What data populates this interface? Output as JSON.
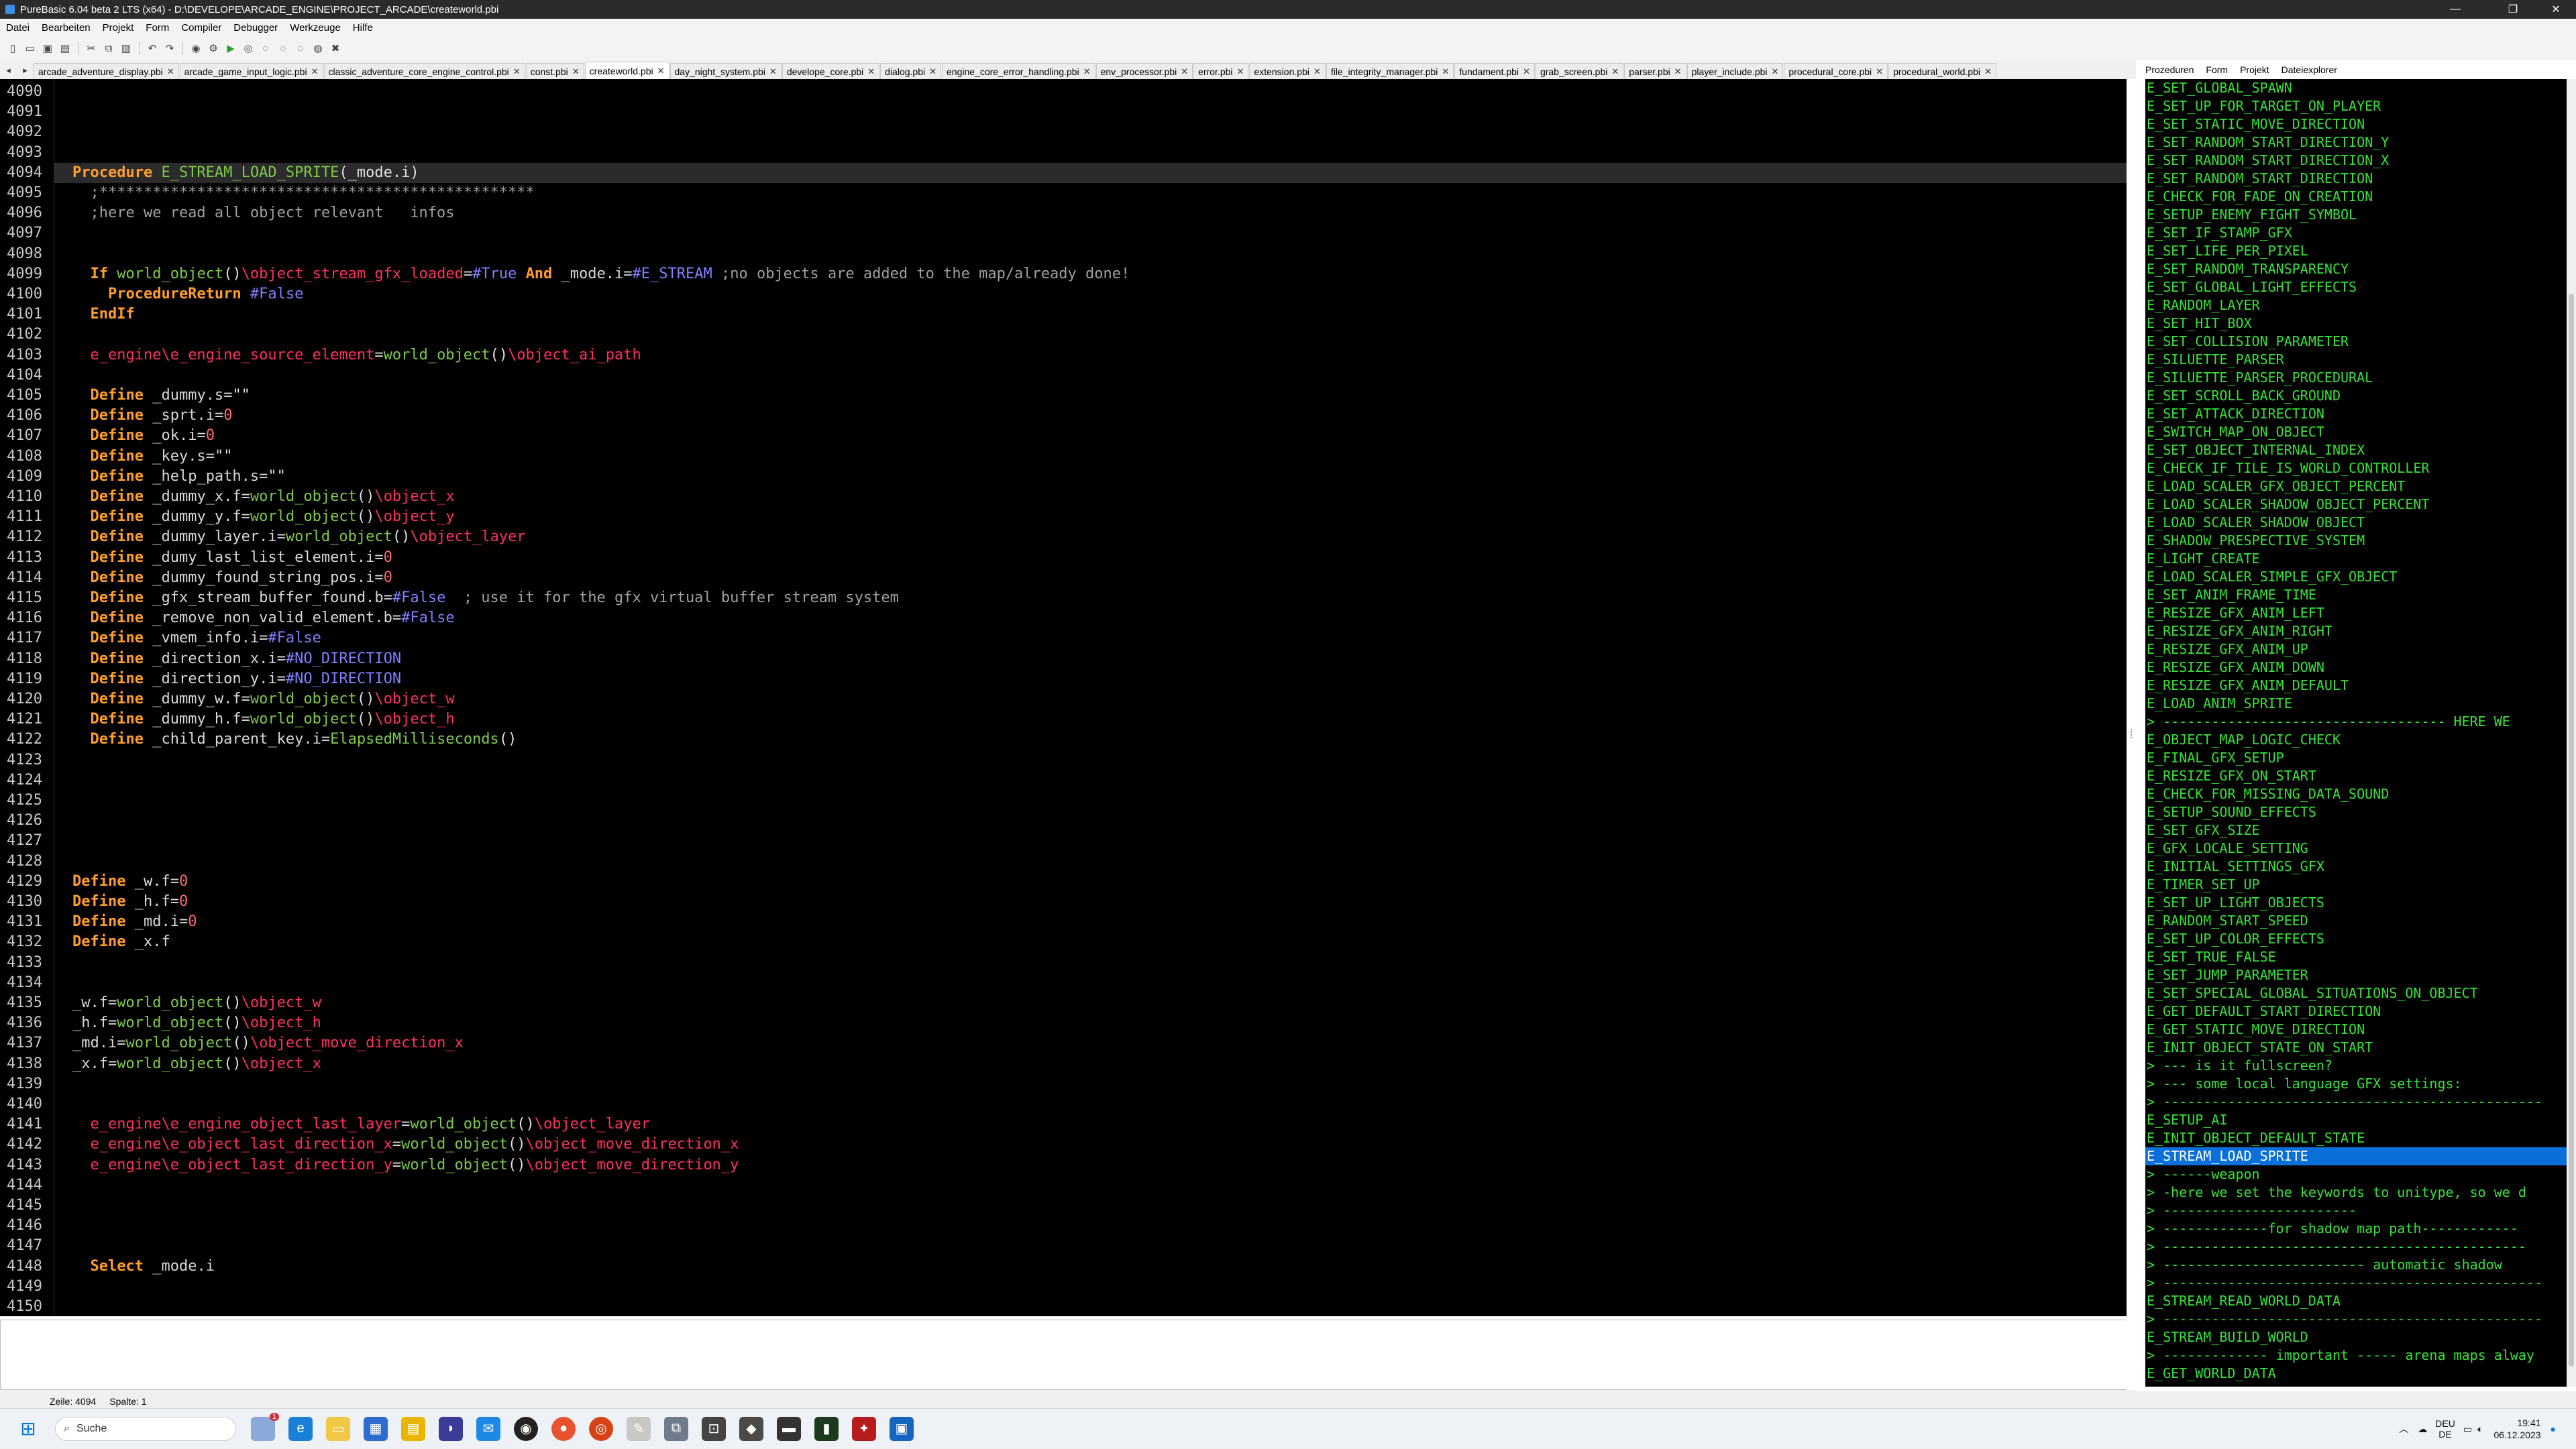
{
  "titlebar": {
    "title": "PureBasic 6.04 beta 2 LTS (x64) - D:\\DEVELOPE\\ARCADE_ENGINE\\PROJECT_ARCADE\\createworld.pbi",
    "minimize": "—",
    "maximize": "❐",
    "close": "✕"
  },
  "menu": [
    "Datei",
    "Bearbeiten",
    "Projekt",
    "Form",
    "Compiler",
    "Debugger",
    "Werkzeuge",
    "Hilfe"
  ],
  "tabs": [
    "arcade_adventure_display.pbi",
    "arcade_game_input_logic.pbi",
    "classic_adventure_core_engine_control.pbi",
    "const.pbi",
    "createworld.pbi",
    "day_night_system.pbi",
    "develope_core.pbi",
    "dialog.pbi",
    "engine_core_error_handling.pbi",
    "env_processor.pbi",
    "error.pbi",
    "extension.pbi",
    "file_integrity_manager.pbi",
    "fundament.pbi",
    "grab_screen.pbi",
    "parser.pbi",
    "player_include.pbi",
    "procedural_core.pbi",
    "procedural_world.pbi"
  ],
  "active_tab": "createworld.pbi",
  "editor": {
    "line_numbers": [
      "4090",
      "4091",
      "4092",
      "4093",
      "4094",
      "4095",
      "4096",
      "4097",
      "4098",
      "4099",
      "4100",
      "4101",
      "4102",
      "4103",
      "4104",
      "4105",
      "4106",
      "4107",
      "4108",
      "4109",
      "4110",
      "4111",
      "4112",
      "4113",
      "4114",
      "4115",
      "4116",
      "4117",
      "4118",
      "4119",
      "4120",
      "4121",
      "4122",
      "4123",
      "4124",
      "4125",
      "4126",
      "4127",
      "4128",
      "4129",
      "4130",
      "4131",
      "4132",
      "4133",
      "4134",
      "4135",
      "4136",
      "4137",
      "4138",
      "4139",
      "4140",
      "4141",
      "4142",
      "4143",
      "4144",
      "4145",
      "4146",
      "4147",
      "4148",
      "4149",
      "4150"
    ],
    "lines": [
      {
        "i": 4,
        "cur": true,
        "t": [
          [
            "kw",
            "Procedure "
          ],
          [
            "fn",
            "E_STREAM_LOAD_SPRITE"
          ],
          [
            "br",
            "(_mode.i)"
          ]
        ]
      },
      {
        "i": 5,
        "t": [
          [
            "cm",
            "  ;*************************************************"
          ]
        ]
      },
      {
        "i": 6,
        "t": [
          [
            "cm",
            "  ;here we read all object relevant   infos"
          ]
        ]
      },
      {
        "i": 9,
        "t": [
          [
            "kw",
            "  If "
          ],
          [
            "fn",
            "world_object"
          ],
          [
            "br",
            "()"
          ],
          [
            "rg",
            "\\object_stream_gfx_loaded"
          ],
          [
            "op",
            "="
          ],
          [
            "ct",
            "#True "
          ],
          [
            "kw",
            "And "
          ],
          [
            "vr",
            "_mode.i"
          ],
          [
            "op",
            "="
          ],
          [
            "ct",
            "#E_STREAM "
          ],
          [
            "cm",
            ";no objects are added to the map/already done!"
          ]
        ]
      },
      {
        "i": 10,
        "t": [
          [
            "kw",
            "    ProcedureReturn "
          ],
          [
            "ct",
            "#False"
          ]
        ]
      },
      {
        "i": 11,
        "t": [
          [
            "kw",
            "  EndIf"
          ]
        ]
      },
      {
        "i": 13,
        "t": [
          [
            "rg",
            "  e_engine\\e_engine_source_element"
          ],
          [
            "op",
            "="
          ],
          [
            "fn",
            "world_object"
          ],
          [
            "br",
            "()"
          ],
          [
            "rg",
            "\\object_ai_path"
          ]
        ]
      },
      {
        "i": 15,
        "t": [
          [
            "kw",
            "  Define "
          ],
          [
            "vr",
            "_dummy.s"
          ],
          [
            "op",
            "="
          ],
          [
            "st",
            "\"\""
          ]
        ]
      },
      {
        "i": 16,
        "t": [
          [
            "kw",
            "  Define "
          ],
          [
            "vr",
            "_sprt.i"
          ],
          [
            "op",
            "="
          ],
          [
            "nm",
            "0"
          ]
        ]
      },
      {
        "i": 17,
        "t": [
          [
            "kw",
            "  Define "
          ],
          [
            "vr",
            "_ok.i"
          ],
          [
            "op",
            "="
          ],
          [
            "nm",
            "0"
          ]
        ]
      },
      {
        "i": 18,
        "t": [
          [
            "kw",
            "  Define "
          ],
          [
            "vr",
            "_key.s"
          ],
          [
            "op",
            "="
          ],
          [
            "st",
            "\"\""
          ]
        ]
      },
      {
        "i": 19,
        "t": [
          [
            "kw",
            "  Define "
          ],
          [
            "vr",
            "_help_path.s"
          ],
          [
            "op",
            "="
          ],
          [
            "st",
            "\"\""
          ]
        ]
      },
      {
        "i": 20,
        "t": [
          [
            "kw",
            "  Define "
          ],
          [
            "vr",
            "_dummy_x.f"
          ],
          [
            "op",
            "="
          ],
          [
            "fn",
            "world_object"
          ],
          [
            "br",
            "()"
          ],
          [
            "rg",
            "\\object_x"
          ]
        ]
      },
      {
        "i": 21,
        "t": [
          [
            "kw",
            "  Define "
          ],
          [
            "vr",
            "_dummy_y.f"
          ],
          [
            "op",
            "="
          ],
          [
            "fn",
            "world_object"
          ],
          [
            "br",
            "()"
          ],
          [
            "rg",
            "\\object_y"
          ]
        ]
      },
      {
        "i": 22,
        "t": [
          [
            "kw",
            "  Define "
          ],
          [
            "vr",
            "_dummy_layer.i"
          ],
          [
            "op",
            "="
          ],
          [
            "fn",
            "world_object"
          ],
          [
            "br",
            "()"
          ],
          [
            "rg",
            "\\object_layer"
          ]
        ]
      },
      {
        "i": 23,
        "t": [
          [
            "kw",
            "  Define "
          ],
          [
            "vr",
            "_dumy_last_list_element.i"
          ],
          [
            "op",
            "="
          ],
          [
            "nm",
            "0"
          ]
        ]
      },
      {
        "i": 24,
        "t": [
          [
            "kw",
            "  Define "
          ],
          [
            "vr",
            "_dummy_found_string_pos.i"
          ],
          [
            "op",
            "="
          ],
          [
            "nm",
            "0"
          ]
        ]
      },
      {
        "i": 25,
        "t": [
          [
            "kw",
            "  Define "
          ],
          [
            "vr",
            "_gfx_stream_buffer_found.b"
          ],
          [
            "op",
            "="
          ],
          [
            "ct",
            "#False  "
          ],
          [
            "cm",
            "; use it for the gfx virtual buffer stream system"
          ]
        ]
      },
      {
        "i": 26,
        "t": [
          [
            "kw",
            "  Define "
          ],
          [
            "vr",
            "_remove_non_valid_element.b"
          ],
          [
            "op",
            "="
          ],
          [
            "ct",
            "#False"
          ]
        ]
      },
      {
        "i": 27,
        "t": [
          [
            "kw",
            "  Define "
          ],
          [
            "vr",
            "_vmem_info.i"
          ],
          [
            "op",
            "="
          ],
          [
            "ct",
            "#False"
          ]
        ]
      },
      {
        "i": 28,
        "t": [
          [
            "kw",
            "  Define "
          ],
          [
            "vr",
            "_direction_x.i"
          ],
          [
            "op",
            "="
          ],
          [
            "ct",
            "#NO_DIRECTION"
          ]
        ]
      },
      {
        "i": 29,
        "t": [
          [
            "kw",
            "  Define "
          ],
          [
            "vr",
            "_direction_y.i"
          ],
          [
            "op",
            "="
          ],
          [
            "ct",
            "#NO_DIRECTION"
          ]
        ]
      },
      {
        "i": 30,
        "t": [
          [
            "kw",
            "  Define "
          ],
          [
            "vr",
            "_dummy_w.f"
          ],
          [
            "op",
            "="
          ],
          [
            "fn",
            "world_object"
          ],
          [
            "br",
            "()"
          ],
          [
            "rg",
            "\\object_w"
          ]
        ]
      },
      {
        "i": 31,
        "t": [
          [
            "kw",
            "  Define "
          ],
          [
            "vr",
            "_dummy_h.f"
          ],
          [
            "op",
            "="
          ],
          [
            "fn",
            "world_object"
          ],
          [
            "br",
            "()"
          ],
          [
            "rg",
            "\\object_h"
          ]
        ]
      },
      {
        "i": 32,
        "t": [
          [
            "kw",
            "  Define "
          ],
          [
            "vr",
            "_child_parent_key.i"
          ],
          [
            "op",
            "="
          ],
          [
            "fn",
            "ElapsedMilliseconds"
          ],
          [
            "br",
            "()"
          ]
        ]
      },
      {
        "i": 39,
        "t": [
          [
            "kw",
            "Define "
          ],
          [
            "vr",
            "_w.f"
          ],
          [
            "op",
            "="
          ],
          [
            "nm",
            "0"
          ]
        ]
      },
      {
        "i": 40,
        "t": [
          [
            "kw",
            "Define "
          ],
          [
            "vr",
            "_h.f"
          ],
          [
            "op",
            "="
          ],
          [
            "nm",
            "0"
          ]
        ]
      },
      {
        "i": 41,
        "t": [
          [
            "kw",
            "Define "
          ],
          [
            "vr",
            "_md.i"
          ],
          [
            "op",
            "="
          ],
          [
            "nm",
            "0"
          ]
        ]
      },
      {
        "i": 42,
        "t": [
          [
            "kw",
            "Define "
          ],
          [
            "vr",
            "_x.f"
          ]
        ]
      },
      {
        "i": 45,
        "t": [
          [
            "vr",
            "_w.f"
          ],
          [
            "op",
            "="
          ],
          [
            "fn",
            "world_object"
          ],
          [
            "br",
            "()"
          ],
          [
            "rg",
            "\\object_w"
          ]
        ]
      },
      {
        "i": 46,
        "t": [
          [
            "vr",
            "_h.f"
          ],
          [
            "op",
            "="
          ],
          [
            "fn",
            "world_object"
          ],
          [
            "br",
            "()"
          ],
          [
            "rg",
            "\\object_h"
          ]
        ]
      },
      {
        "i": 47,
        "t": [
          [
            "vr",
            "_md.i"
          ],
          [
            "op",
            "="
          ],
          [
            "fn",
            "world_object"
          ],
          [
            "br",
            "()"
          ],
          [
            "rg",
            "\\object_move_direction_x"
          ]
        ]
      },
      {
        "i": 48,
        "t": [
          [
            "vr",
            "_x.f"
          ],
          [
            "op",
            "="
          ],
          [
            "fn",
            "world_object"
          ],
          [
            "br",
            "()"
          ],
          [
            "rg",
            "\\object_x"
          ]
        ]
      },
      {
        "i": 51,
        "t": [
          [
            "rg",
            "  e_engine\\e_engine_object_last_layer"
          ],
          [
            "op",
            "="
          ],
          [
            "fn",
            "world_object"
          ],
          [
            "br",
            "()"
          ],
          [
            "rg",
            "\\object_layer"
          ]
        ]
      },
      {
        "i": 52,
        "t": [
          [
            "rg",
            "  e_engine\\e_object_last_direction_x"
          ],
          [
            "op",
            "="
          ],
          [
            "fn",
            "world_object"
          ],
          [
            "br",
            "()"
          ],
          [
            "rg",
            "\\object_move_direction_x"
          ]
        ]
      },
      {
        "i": 53,
        "t": [
          [
            "rg",
            "  e_engine\\e_object_last_direction_y"
          ],
          [
            "op",
            "="
          ],
          [
            "fn",
            "world_object"
          ],
          [
            "br",
            "()"
          ],
          [
            "rg",
            "\\object_move_direction_y"
          ]
        ]
      },
      {
        "i": 58,
        "t": [
          [
            "kw",
            "  Select "
          ],
          [
            "vr",
            "_mode.i"
          ]
        ]
      }
    ]
  },
  "status": {
    "line": "Zeile: 4094",
    "col": "Spalte: 1"
  },
  "right_tabs": [
    "Prozeduren",
    "Form",
    "Projekt",
    "Dateiexplorer"
  ],
  "procedures": [
    "E_SET_GLOBAL_SPAWN",
    "E_SET_UP_FOR_TARGET_ON_PLAYER",
    "E_SET_STATIC_MOVE_DIRECTION",
    "E_SET_RANDOM_START_DIRECTION_Y",
    "E_SET_RANDOM_START_DIRECTION_X",
    "E_SET_RANDOM_START_DIRECTION",
    "E_CHECK_FOR_FADE_ON_CREATION",
    "E_SETUP_ENEMY_FIGHT_SYMBOL",
    "E_SET_IF_STAMP_GFX",
    "E_SET_LIFE_PER_PIXEL",
    "E_SET_RANDOM_TRANSPARENCY",
    "E_SET_GLOBAL_LIGHT_EFFECTS",
    "E_RANDOM_LAYER",
    "E_SET_HIT_BOX",
    "E_SET_COLLISION_PARAMETER",
    "E_SILUETTE_PARSER",
    "E_SILUETTE_PARSER_PROCEDURAL",
    "E_SET_SCROLL_BACK_GROUND",
    "E_SET_ATTACK_DIRECTION",
    "E_SWITCH_MAP_ON_OBJECT",
    "E_SET_OBJECT_INTERNAL_INDEX",
    "E_CHECK_IF_TILE_IS_WORLD_CONTROLLER",
    "E_LOAD_SCALER_GFX_OBJECT_PERCENT",
    "E_LOAD_SCALER_SHADOW_OBJECT_PERCENT",
    "E_LOAD_SCALER_SHADOW_OBJECT",
    "E_SHADOW_PRESPECTIVE_SYSTEM",
    "E_LIGHT_CREATE",
    "E_LOAD_SCALER_SIMPLE_GFX_OBJECT",
    "E_SET_ANIM_FRAME_TIME",
    "E_RESIZE_GFX_ANIM_LEFT",
    "E_RESIZE_GFX_ANIM_RIGHT",
    "E_RESIZE_GFX_ANIM_UP",
    "E_RESIZE_GFX_ANIM_DOWN",
    "E_RESIZE_GFX_ANIM_DEFAULT",
    "E_LOAD_ANIM_SPRITE",
    "> ----------------------------------- HERE WE",
    "E_OBJECT_MAP_LOGIC_CHECK",
    "E_FINAL_GFX_SETUP",
    "E_RESIZE_GFX_ON_START",
    "E_CHECK_FOR_MISSING_DATA_SOUND",
    "E_SETUP_SOUND_EFFECTS",
    "E_SET_GFX_SIZE",
    "E_GFX_LOCALE_SETTING",
    "E_INITIAL_SETTINGS_GFX",
    "E_TIMER_SET_UP",
    "E_SET_UP_LIGHT_OBJECTS",
    "E_RANDOM_START_SPEED",
    "E_SET_UP_COLOR_EFFECTS",
    "E_SET_TRUE_FALSE",
    "E_SET_JUMP_PARAMETER",
    "E_SET_SPECIAL_GLOBAL_SITUATIONS_ON_OBJECT",
    "E_GET_DEFAULT_START_DIRECTION",
    "E_GET_STATIC_MOVE_DIRECTION",
    "E_INIT_OBJECT_STATE_ON_START",
    "> --- is it fullscreen?",
    "> --- some local language GFX settings:",
    "> -----------------------------------------------",
    "E_SETUP_AI",
    "E_INIT_OBJECT_DEFAULT_STATE",
    "E_STREAM_LOAD_SPRITE",
    "> ------weapon",
    "> -here we set the keywords to unitype, so we d",
    "> ------------------------",
    "> -------------for shadow map path------------",
    "> ---------------------------------------------",
    "> ------------------------- automatic shadow",
    "> -----------------------------------------------",
    "E_STREAM_READ_WORLD_DATA",
    "> -----------------------------------------------",
    "E_STREAM_BUILD_WORLD",
    "> ------------- important ----- arena maps alway",
    "E_GET_WORLD_DATA"
  ],
  "selected_procedure": "E_STREAM_LOAD_SPRITE",
  "taskbar": {
    "search": "Suche",
    "lang1": "DEU",
    "lang2": "DE",
    "time": "19:41",
    "date": "06.12.2023",
    "badge": "1"
  },
  "colors": {
    "keyword": "#ff9e2c",
    "function": "#7ecb47",
    "constant": "#8080ff",
    "comment": "#a0a0a0",
    "field": "#ff3060",
    "procs": "#35e335",
    "selection": "#0a6fd8"
  }
}
